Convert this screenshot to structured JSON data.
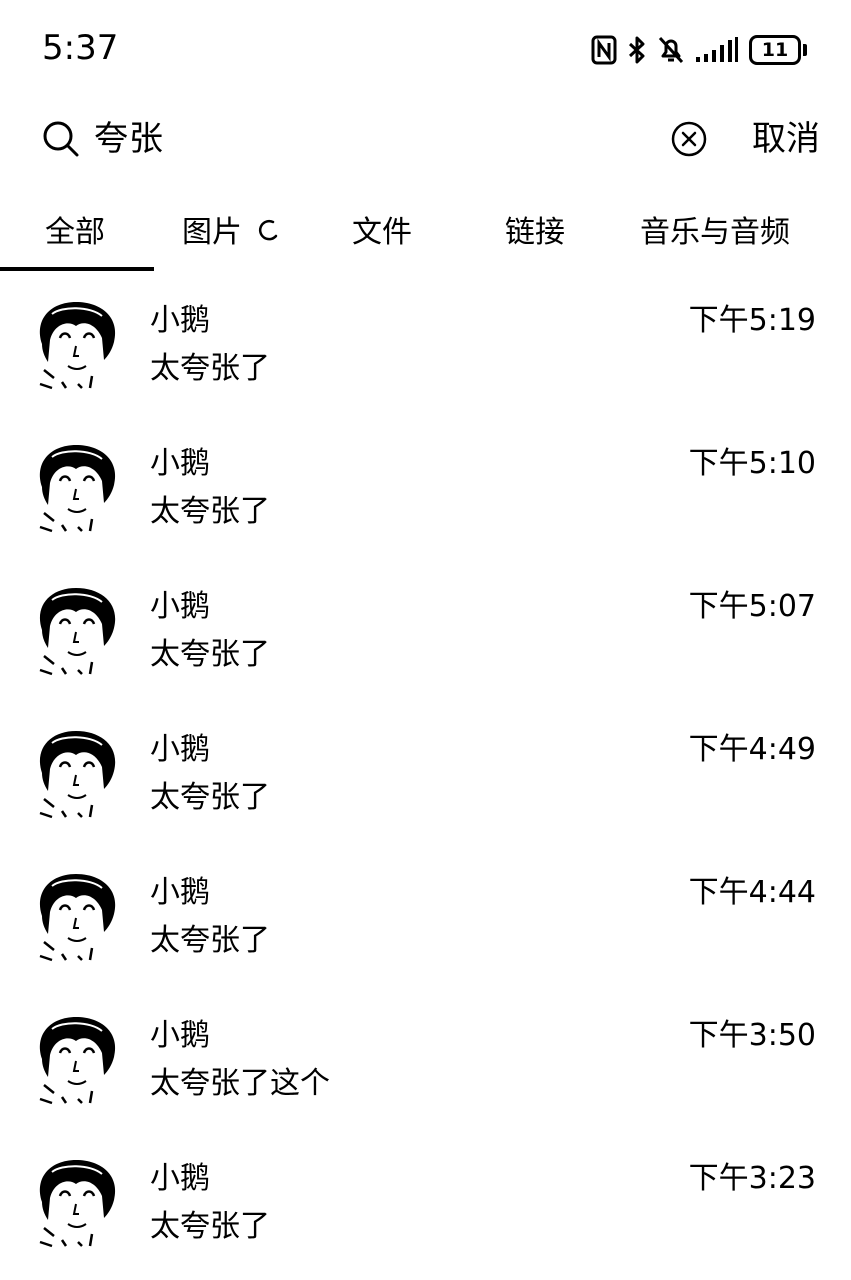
{
  "status_bar": {
    "time": "5:37",
    "battery_level": "11",
    "icons": [
      "nfc-icon",
      "bluetooth-icon",
      "mute-icon",
      "signal-icon",
      "battery-icon"
    ]
  },
  "search": {
    "query": "夸张",
    "cancel_label": "取消",
    "icons": [
      "search-icon",
      "clear-icon"
    ]
  },
  "tabs": [
    {
      "label": "全部",
      "selected": true
    },
    {
      "label": "图片",
      "selected": false,
      "loading": true
    },
    {
      "label": "文件",
      "selected": false
    },
    {
      "label": "链接",
      "selected": false
    },
    {
      "label": "音乐与音频",
      "selected": false
    }
  ],
  "results": [
    {
      "sender": "小鹅",
      "message": "太夸张了",
      "time": "下午5:19"
    },
    {
      "sender": "小鹅",
      "message": "太夸张了",
      "time": "下午5:10"
    },
    {
      "sender": "小鹅",
      "message": "太夸张了",
      "time": "下午5:07"
    },
    {
      "sender": "小鹅",
      "message": "太夸张了",
      "time": "下午4:49"
    },
    {
      "sender": "小鹅",
      "message": "太夸张了",
      "time": "下午4:44"
    },
    {
      "sender": "小鹅",
      "message": "太夸张了这个",
      "time": "下午3:50"
    },
    {
      "sender": "小鹅",
      "message": "太夸张了",
      "time": "下午3:23"
    }
  ],
  "colors": {
    "text": "#000000",
    "background": "#ffffff",
    "accent": "#000000"
  }
}
